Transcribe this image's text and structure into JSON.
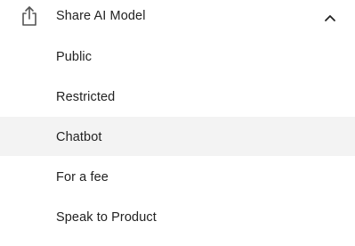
{
  "menu": {
    "header": {
      "title": "Share AI Model",
      "icon": "share-upload-icon",
      "expanded": true,
      "chevron_icon": "chevron-up-icon"
    },
    "items": [
      {
        "label": "Public",
        "selected": false
      },
      {
        "label": "Restricted",
        "selected": false
      },
      {
        "label": "Chatbot",
        "selected": true
      },
      {
        "label": "For a fee",
        "selected": false
      },
      {
        "label": "Speak to Product",
        "selected": false
      }
    ],
    "colors": {
      "selected_background": "#f3f3f3",
      "text": "#222222",
      "icon": "#555555"
    }
  }
}
